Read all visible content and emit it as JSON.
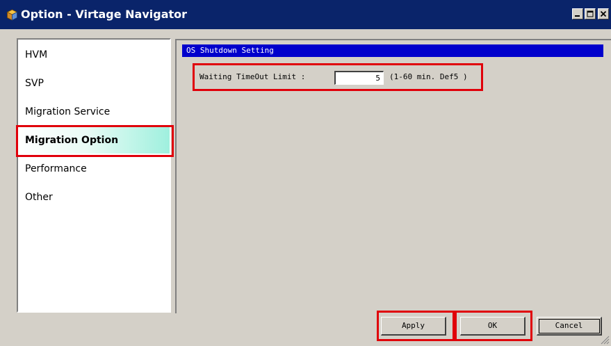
{
  "window": {
    "title": "Option - Virtage Navigator"
  },
  "nav": {
    "items": [
      {
        "label": "HVM"
      },
      {
        "label": "SVP"
      },
      {
        "label": "Migration Service"
      },
      {
        "label": "Migration Option",
        "selected": true
      },
      {
        "label": "Performance"
      },
      {
        "label": "Other"
      }
    ]
  },
  "content": {
    "group_title": "OS Shutdown Setting",
    "field_label": "Waiting TimeOut Limit :",
    "field_value": "5",
    "field_hint": "(1-60 min. Def5 )"
  },
  "buttons": {
    "apply": "Apply",
    "ok": "OK",
    "cancel": "Cancel"
  },
  "icons": {
    "app": "app-cube-icon",
    "minimize": "minimize-icon",
    "maximize": "maximize-icon",
    "close": "close-icon",
    "resize": "resize-grip-icon"
  },
  "colors": {
    "titlebar": "#0a246a",
    "group_header": "#0000cc",
    "highlight": "#e0000a",
    "selected_gradient_end": "#9ff0de"
  }
}
